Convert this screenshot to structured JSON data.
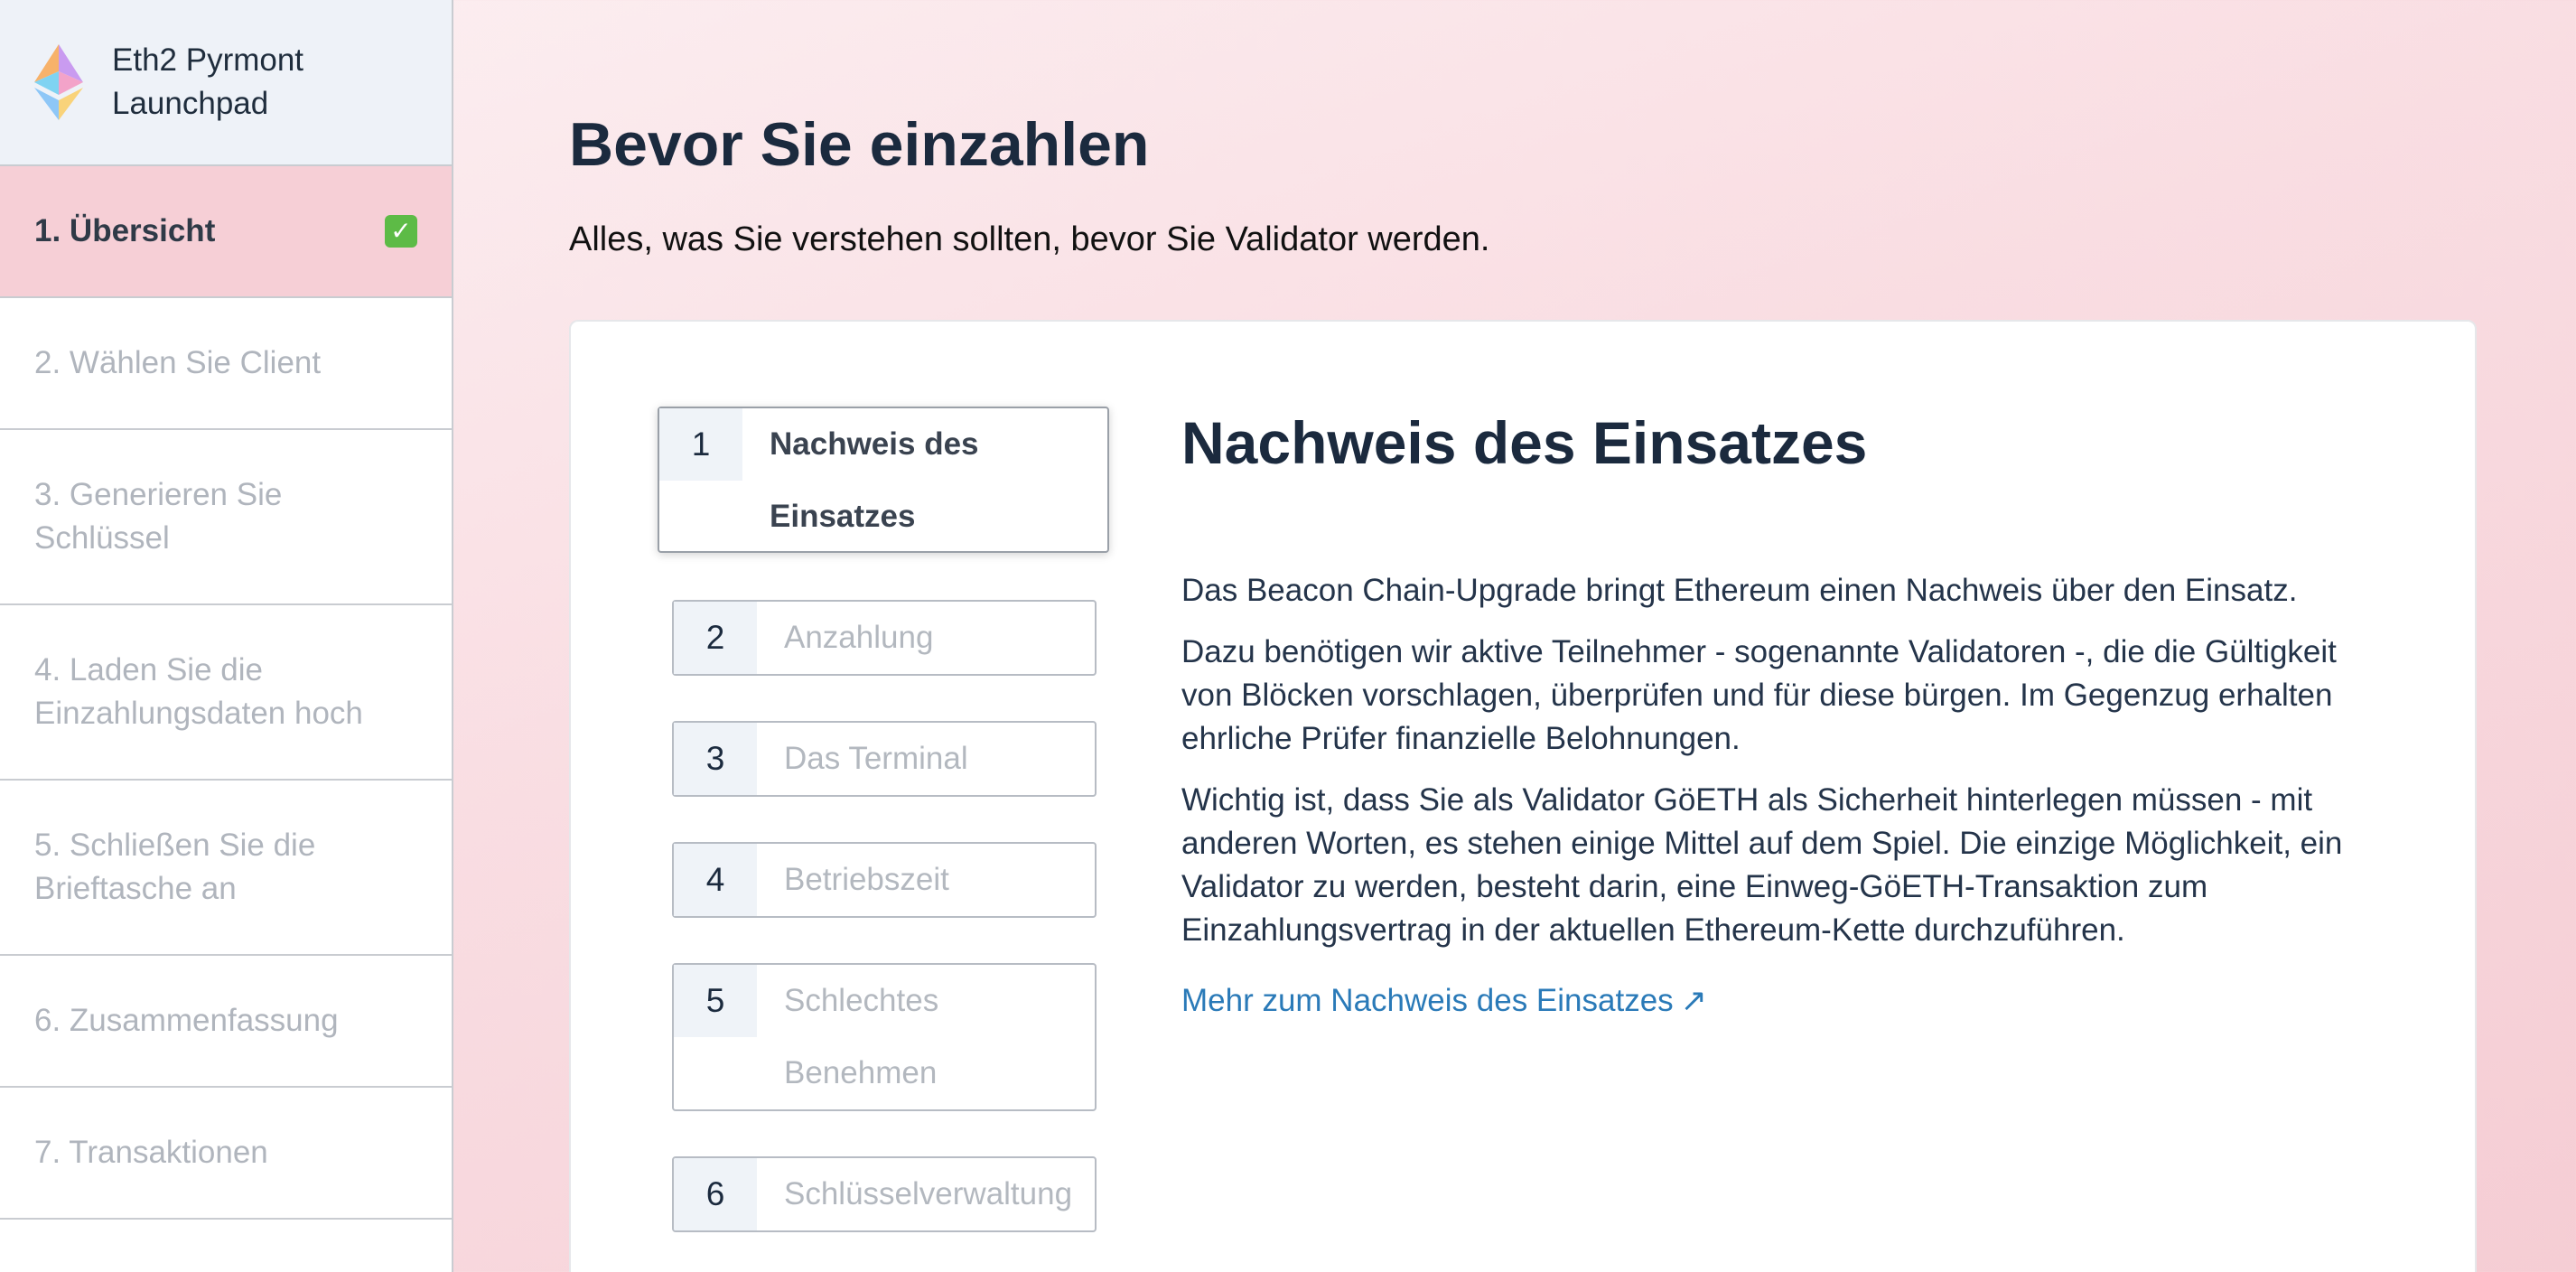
{
  "sidebar": {
    "brand": {
      "title": "Eth2 Pyrmont Launchpad"
    },
    "items": [
      {
        "label": "1. Übersicht"
      },
      {
        "label": "2. Wählen Sie Client"
      },
      {
        "label": "3. Generieren Sie Schlüssel"
      },
      {
        "label": "4. Laden Sie die Einzahlungsdaten hoch"
      },
      {
        "label": "5. Schließen Sie die Brieftasche an"
      },
      {
        "label": "6. Zusammenfassung"
      },
      {
        "label": "7. Transaktionen"
      }
    ],
    "active_check_icon": "check-mark-icon"
  },
  "main": {
    "title": "Bevor Sie einzahlen",
    "subtitle": "Alles, was Sie verstehen sollten, bevor Sie Validator werden.",
    "steps": [
      {
        "num": "1",
        "label_line1": "Nachweis des",
        "label_line2": "Einsatzes"
      },
      {
        "num": "2",
        "label": "Anzahlung"
      },
      {
        "num": "3",
        "label": "Das Terminal"
      },
      {
        "num": "4",
        "label": "Betriebszeit"
      },
      {
        "num": "5",
        "label_line1": "Schlechtes",
        "label_line2": "Benehmen"
      },
      {
        "num": "6",
        "label": "Schlüsselverwaltung"
      }
    ],
    "content": {
      "title": "Nachweis des Einsatzes",
      "paragraphs": [
        "Das Beacon Chain-Upgrade bringt Ethereum einen Nachweis über den Einsatz.",
        "Dazu benötigen wir aktive Teilnehmer - sogenannte Validatoren -, die die Gültigkeit von Blöcken vorschlagen, überprüfen und für diese bürgen. Im Gegenzug erhalten ehrliche Prüfer finanzielle Belohnungen.",
        "Wichtig ist, dass Sie als Validator GöETH als Sicherheit hinterlegen müssen - mit anderen Worten, es stehen einige Mittel auf dem Spiel. Die einzige Möglichkeit, ein Validator zu werden, besteht darin, eine Einweg-GöETH-Transaktion zum Einzahlungsvertrag in der aktuellen Ethereum-Kette durchzuführen."
      ],
      "link": "Mehr zum Nachweis des Einsatzes",
      "link_arrow": "↗"
    }
  },
  "colors": {
    "active_nav_bg": "#f6cfd6",
    "link": "#2a7ab8",
    "heading": "#1b2a3e"
  }
}
